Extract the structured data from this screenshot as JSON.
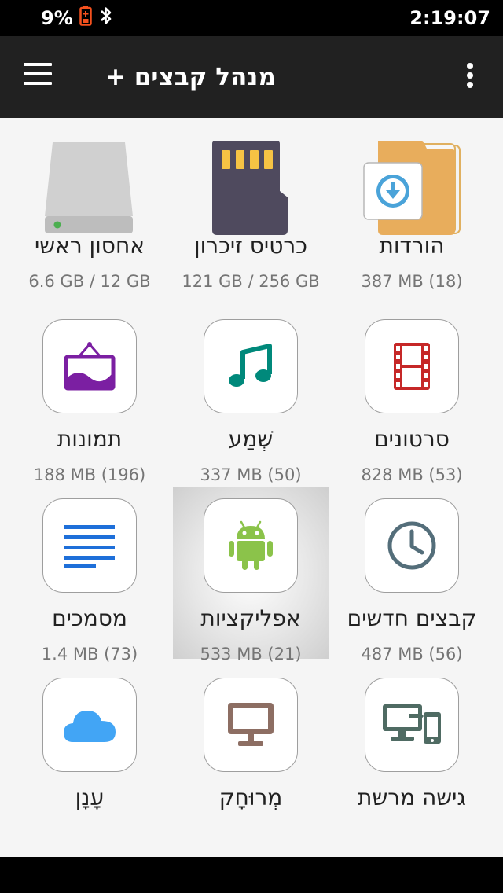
{
  "status": {
    "battery": "9%",
    "time": "2:19:07"
  },
  "header": {
    "title": "מנהל קבצים +"
  },
  "tiles": [
    {
      "label": "אחסון ראשי",
      "sub": "6.6 GB / 12 GB"
    },
    {
      "label": "כרטיס זיכרון",
      "sub": "121 GB / 256 GB"
    },
    {
      "label": "הורדות",
      "sub": "387 MB (18)"
    },
    {
      "label": "תמונות",
      "sub": "188 MB (196)"
    },
    {
      "label": "שְׁמַע",
      "sub": "337 MB (50)"
    },
    {
      "label": "סרטונים",
      "sub": "828 MB (53)"
    },
    {
      "label": "מסמכים",
      "sub": "1.4 MB (73)"
    },
    {
      "label": "אפליקציות",
      "sub": "533 MB (21)"
    },
    {
      "label": "קבצים חדשים",
      "sub": "487 MB (56)"
    },
    {
      "label": "עָנָן",
      "sub": ""
    },
    {
      "label": "מְרוּחָק",
      "sub": ""
    },
    {
      "label": "גישה מרשת",
      "sub": ""
    }
  ],
  "colors": {
    "app_bar": "#212121",
    "status_bar": "#000000",
    "background": "#f5f5f5",
    "battery_low": "#f4511e",
    "image_purple": "#7b1fa2",
    "audio_teal": "#00897b",
    "video_red": "#c62828",
    "doc_blue": "#1e6fd9",
    "android_green": "#8bc34a",
    "history_slate": "#546e7a",
    "cloud_blue": "#42a5f5",
    "remote_brown": "#8d6e63",
    "network_gray": "#4f6b63"
  }
}
